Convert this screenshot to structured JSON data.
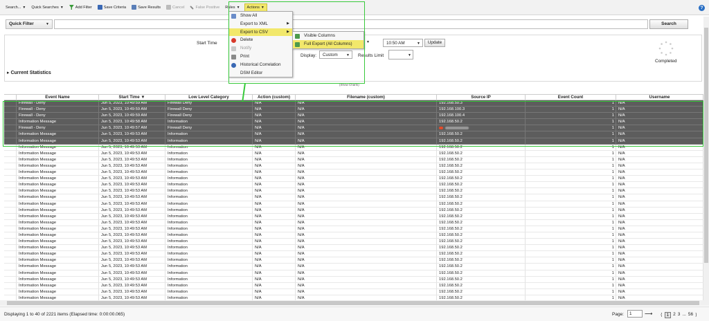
{
  "toolbar": {
    "items": [
      {
        "label": "Search...",
        "icon": "caret-icon"
      },
      {
        "label": "Quick Searches",
        "icon": "caret-icon"
      },
      {
        "label": "Add Filter",
        "icon": "filter-icon"
      },
      {
        "label": "Save Criteria",
        "icon": "save-icon"
      },
      {
        "label": "Save Results",
        "icon": "save-results-icon"
      },
      {
        "label": "Cancel",
        "icon": "cancel-icon"
      },
      {
        "label": "False Positive",
        "icon": "wrench-icon"
      },
      {
        "label": "Rules",
        "icon": "caret-icon"
      }
    ],
    "actions_label": "Actions"
  },
  "quick_filter": {
    "label": "Quick Filter",
    "value": "",
    "search_label": "Search"
  },
  "criteria": {
    "start_time_label": "Start Time",
    "time_value": "10:50 AM",
    "update_label": "Update",
    "display_label": "Display:",
    "display_value": "Custom",
    "results_limit_label": "Results Limit",
    "status": "Completed",
    "current_statistics": "Current Statistics",
    "show_charts": "(Show Charts)"
  },
  "actions_menu": {
    "items": [
      {
        "label": "Show All",
        "icon": "show-all-icon"
      },
      {
        "label": "Export to XML",
        "icon": "",
        "submenu": true
      },
      {
        "label": "Export to CSV",
        "icon": "",
        "submenu": true,
        "highlighted": true
      },
      {
        "label": "Delete",
        "icon": "delete-icon"
      },
      {
        "label": "Notify",
        "icon": "notify-icon",
        "disabled": true
      },
      {
        "label": "Print",
        "icon": "print-icon"
      },
      {
        "label": "Historical Correlation",
        "icon": "historical-correlation-icon"
      },
      {
        "label": "DSM Editor",
        "icon": ""
      }
    ],
    "csv_submenu": [
      {
        "label": "Visible Columns",
        "icon": "visible-columns-icon"
      },
      {
        "label": "Full Export (All Columns)",
        "icon": "full-export-icon",
        "highlighted": true
      }
    ]
  },
  "table": {
    "columns": [
      "Event Name",
      "Start Time",
      "Low Level Category",
      "Action (custom)",
      "Filename (custom)",
      "Source IP",
      "Event Count",
      "Username"
    ],
    "sort_column": "Start Time",
    "selected_rows": [
      {
        "event": "Firewall - Deny",
        "time": "Jun 5, 2023, 10:49:59 AM",
        "category": "Firewall Deny",
        "action": "N/A",
        "filename": "N/A",
        "ip": "192.168.50.3",
        "count": "1",
        "user": "N/A"
      },
      {
        "event": "Firewall - Deny",
        "time": "Jun 5, 2023, 10:49:59 AM",
        "category": "Firewall Deny",
        "action": "N/A",
        "filename": "N/A",
        "ip": "192.168.100.3",
        "count": "1",
        "user": "N/A"
      },
      {
        "event": "Firewall - Deny",
        "time": "Jun 5, 2023, 10:49:59 AM",
        "category": "Firewall Deny",
        "action": "N/A",
        "filename": "N/A",
        "ip": "192.168.100.4",
        "count": "1",
        "user": "N/A"
      },
      {
        "event": "Information Message",
        "time": "Jun 5, 2023, 10:49:58 AM",
        "category": "Information",
        "action": "N/A",
        "filename": "N/A",
        "ip": "192.168.50.2",
        "count": "1",
        "user": "N/A"
      },
      {
        "event": "Firewall - Deny",
        "time": "Jun 5, 2023, 10:49:57 AM",
        "category": "Firewall Deny",
        "action": "N/A",
        "filename": "N/A",
        "ip": "",
        "count": "1",
        "user": "N/A"
      },
      {
        "event": "Information Message",
        "time": "Jun 5, 2023, 10:49:53 AM",
        "category": "Information",
        "action": "N/A",
        "filename": "N/A",
        "ip": "192.168.50.2",
        "count": "1",
        "user": "N/A"
      },
      {
        "event": "Information Message",
        "time": "Jun 5, 2023, 10:49:53 AM",
        "category": "Information",
        "action": "N/A",
        "filename": "N/A",
        "ip": "192.168.50.2",
        "count": "1",
        "user": "N/A"
      }
    ],
    "plain_row": {
      "event": "Information Message",
      "time": "Jun 5, 2023, 10:49:53 AM",
      "category": "Information",
      "action": "N/A",
      "filename": "N/A",
      "ip": "192.168.50.2",
      "count": "1",
      "user": "N/A"
    },
    "plain_row_count": 25
  },
  "footer": {
    "status": "Displaying 1 to 40 of 2221 items (Elapsed time: 0:00:00.065)",
    "page_label": "Page:",
    "page_value": "1",
    "pages": [
      "1",
      "2",
      "3",
      "...",
      "56"
    ],
    "current_page": "1"
  },
  "colors": {
    "highlight": "#f2e86b",
    "selection_row": "#5d5d5d",
    "annotation_green": "#37c93a"
  }
}
